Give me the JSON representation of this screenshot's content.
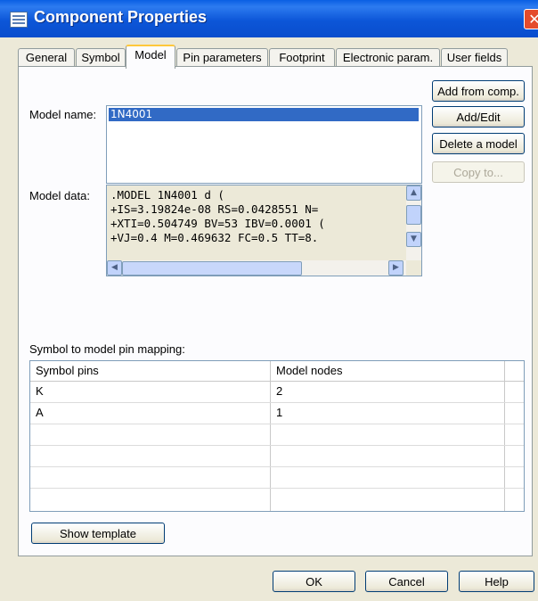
{
  "window": {
    "title": "Component Properties",
    "close_glyph": "✕"
  },
  "tabs": [
    {
      "label": "General"
    },
    {
      "label": "Symbol"
    },
    {
      "label": "Model"
    },
    {
      "label": "Pin parameters"
    },
    {
      "label": "Footprint"
    },
    {
      "label": "Electronic param."
    },
    {
      "label": "User fields"
    }
  ],
  "model": {
    "name_label": "Model name:",
    "models": [
      "1N4001"
    ],
    "data_label": "Model data:",
    "data_lines": [
      ".MODEL 1N4001 d (",
      "+IS=3.19824e-08 RS=0.0428551 N=",
      "+XTI=0.504749 BV=53 IBV=0.0001 (",
      "+VJ=0.4 M=0.469632 FC=0.5 TT=8."
    ],
    "buttons": {
      "add_from_comp": "Add from comp.",
      "add_edit": "Add/Edit",
      "delete": "Delete a model",
      "copy_to": "Copy to..."
    }
  },
  "mapping": {
    "label": "Symbol to model pin mapping:",
    "columns": [
      "Symbol pins",
      "Model nodes"
    ],
    "rows": [
      [
        "K",
        "2"
      ],
      [
        "A",
        "1"
      ]
    ]
  },
  "show_template": "Show template",
  "footer": {
    "ok": "OK",
    "cancel": "Cancel",
    "help": "Help"
  }
}
